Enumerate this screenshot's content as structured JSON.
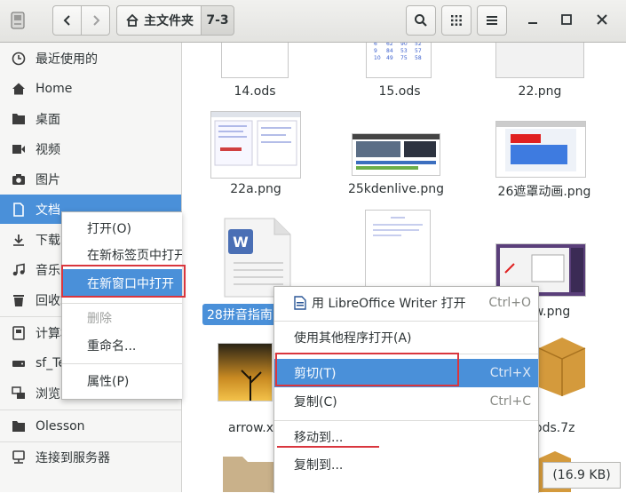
{
  "header": {
    "home_label": "主文件夹",
    "current_folder": "7-3"
  },
  "sidebar": {
    "items": [
      {
        "label": "最近使用的",
        "icon": "clock-icon"
      },
      {
        "label": "Home",
        "icon": "home-icon"
      },
      {
        "label": "桌面",
        "icon": "folder-icon"
      },
      {
        "label": "视频",
        "icon": "video-icon"
      },
      {
        "label": "图片",
        "icon": "camera-icon"
      },
      {
        "label": "文档",
        "icon": "document-icon"
      },
      {
        "label": "下载",
        "icon": "download-icon"
      },
      {
        "label": "音乐",
        "icon": "music-icon"
      },
      {
        "label": "回收站",
        "icon": "trash-icon"
      },
      {
        "label": "计算机",
        "icon": "computer-icon"
      },
      {
        "label": "sf_Te",
        "icon": "drive-icon"
      },
      {
        "label": "浏览网络",
        "icon": "network-icon"
      },
      {
        "label": "Olesson",
        "icon": "folder-icon"
      },
      {
        "label": "连接到服务器",
        "icon": "server-icon"
      }
    ]
  },
  "files": [
    {
      "name": "14.ods"
    },
    {
      "name": "15.ods"
    },
    {
      "name": "22.png"
    },
    {
      "name": "22a.png"
    },
    {
      "name": "25kdenlive.png"
    },
    {
      "name": "26遮罩动画.png"
    },
    {
      "name": "28拼音指南"
    },
    {
      "name": "w.png"
    },
    {
      "name": "arrow.x"
    },
    {
      "name": "ods.7z"
    }
  ],
  "sidebar_menu": {
    "items": [
      {
        "label": "打开(O)"
      },
      {
        "label": "在新标签页中打开"
      },
      {
        "label": "在新窗口中打开"
      },
      {
        "label": "删除"
      },
      {
        "label": "重命名..."
      },
      {
        "label": "属性(P)"
      }
    ]
  },
  "file_menu": {
    "items": [
      {
        "label": "用 LibreOffice Writer 打开",
        "accel": "Ctrl+O"
      },
      {
        "label": "使用其他程序打开(A)",
        "accel": ""
      },
      {
        "label": "剪切(T)",
        "accel": "Ctrl+X"
      },
      {
        "label": "复制(C)",
        "accel": "Ctrl+C"
      },
      {
        "label": "移动到...",
        "accel": ""
      },
      {
        "label": "复制到...",
        "accel": ""
      }
    ]
  },
  "status": {
    "size_text": "(16.9 KB)"
  },
  "colors": {
    "accent": "#4a90d9",
    "annotation": "#d9363e"
  }
}
